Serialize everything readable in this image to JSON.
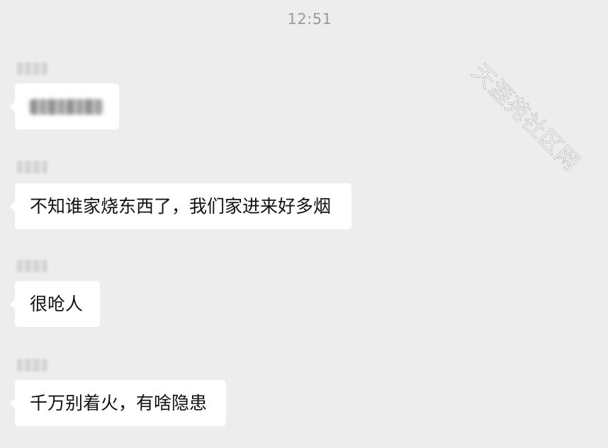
{
  "time_stamp": "12:51",
  "watermark": "天涯苑社区网",
  "messages": [
    {
      "sender": "",
      "text": "",
      "blurred": true
    },
    {
      "sender": "",
      "text": "不知谁家烧东西了，我们家进来好多烟",
      "blurred": false
    },
    {
      "sender": "",
      "text": "很呛人",
      "blurred": false
    },
    {
      "sender": "",
      "text": "千万别着火，有啥隐患",
      "blurred": false
    }
  ]
}
